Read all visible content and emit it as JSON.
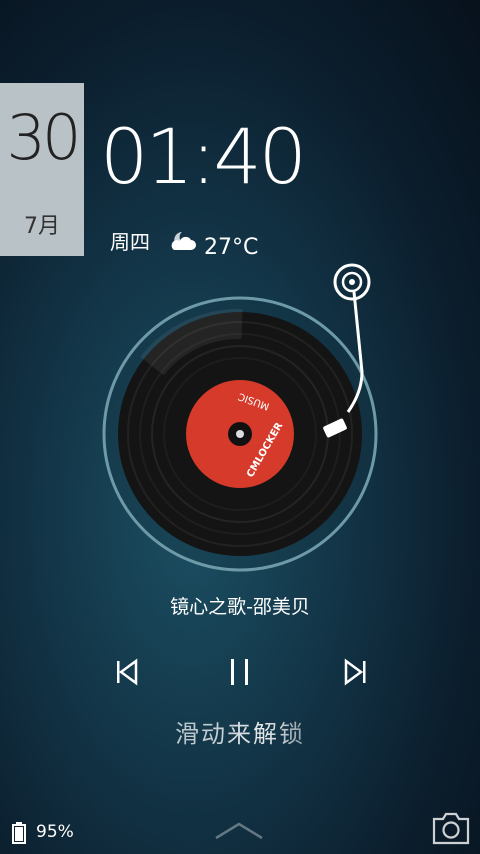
{
  "date": {
    "day": "30",
    "month": "7月"
  },
  "clock": {
    "time": "01:40"
  },
  "weather": {
    "weekday": "周四",
    "temperature": "27°C",
    "icon": "partly-cloudy-night-icon"
  },
  "player": {
    "record_label_top": "MUSIC",
    "record_label_bottom": "CMLOCKER",
    "song_title": "镜心之歌-邵美贝",
    "record_color": "#d63a2a"
  },
  "unlock": {
    "hint": "滑动来解锁"
  },
  "status": {
    "battery": "95%"
  }
}
